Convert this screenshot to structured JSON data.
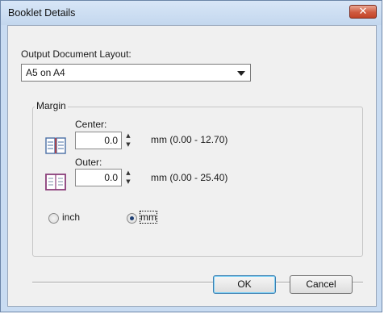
{
  "dialog": {
    "title": "Booklet Details",
    "close_symbol": "✕"
  },
  "layout": {
    "label": "Output Document Layout:",
    "selected": "A5 on A4"
  },
  "margin": {
    "legend": "Margin",
    "center": {
      "label": "Center:",
      "value": "0.0",
      "range": "mm (0.00 - 12.70)",
      "icon": "booklet-center-icon"
    },
    "outer": {
      "label": "Outer:",
      "value": "0.0",
      "range": "mm (0.00 - 25.40)",
      "icon": "booklet-outer-icon"
    }
  },
  "units": {
    "inch_label": "inch",
    "mm_label": "mm",
    "selected": "mm"
  },
  "buttons": {
    "ok": "OK",
    "cancel": "Cancel"
  },
  "colors": {
    "frame": "#c9dcf2",
    "close": "#c24428",
    "icon_center": "#4a6fa5",
    "icon_outer": "#8b3f7a"
  }
}
